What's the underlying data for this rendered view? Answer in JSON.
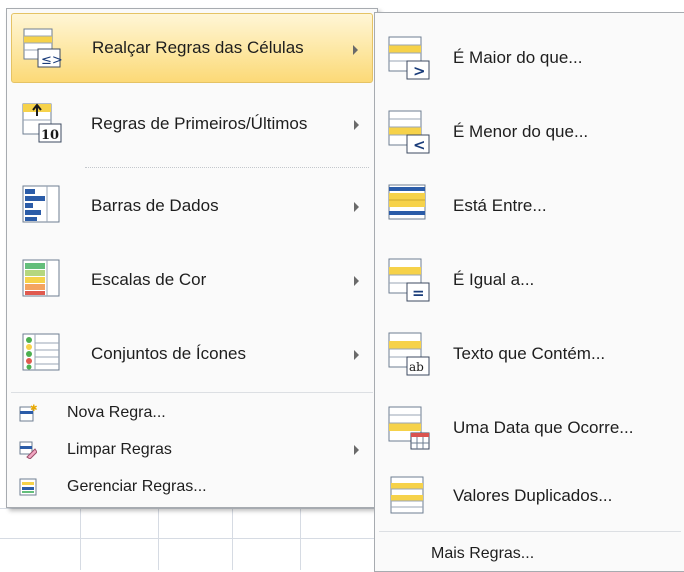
{
  "left_menu": {
    "highlight_rules": "Realçar Regras das Células",
    "top_bottom_rules": "Regras de Primeiros/Últimos",
    "data_bars": "Barras de Dados",
    "color_scales": "Escalas de Cor",
    "icon_sets": "Conjuntos de Ícones",
    "new_rule": "Nova Regra...",
    "clear_rules": "Limpar Regras",
    "manage_rules": "Gerenciar Regras..."
  },
  "submenu": {
    "greater_than": "É Maior do que...",
    "less_than": "É Menor do que...",
    "between": "Está Entre...",
    "equal_to": "É Igual a...",
    "text_contains": "Texto que Contém...",
    "date_occurring": "Uma Data que Ocorre...",
    "duplicate_values": "Valores Duplicados...",
    "more_rules": "Mais Regras..."
  },
  "icons": {
    "highlight": "highlight-cells-icon",
    "top10": "top-bottom-10-icon",
    "databars": "data-bars-icon",
    "colorscales": "color-scales-icon",
    "iconsets": "icon-sets-icon",
    "newrule": "new-rule-icon",
    "clearrules": "clear-rules-icon",
    "managerules": "manage-rules-icon"
  },
  "colors": {
    "hover_top": "#fff6d6",
    "hover_bottom": "#fcd977",
    "menu_bg": "#fafafa",
    "border": "#a7abb0",
    "icon_blue": "#2b5ca8",
    "icon_yellow": "#f6d24a"
  }
}
